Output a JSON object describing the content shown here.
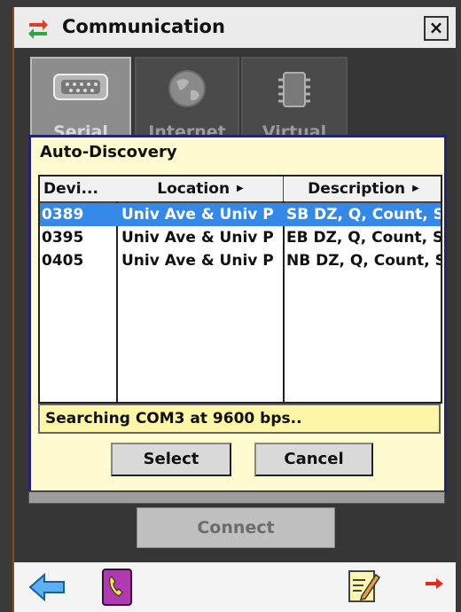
{
  "window": {
    "title": "Communication",
    "close_label": "×"
  },
  "tabs": [
    {
      "label": "Serial",
      "icon": "serial-port-icon"
    },
    {
      "label": "Internet",
      "icon": "globe-icon"
    },
    {
      "label": "Virtual",
      "icon": "chip-icon"
    }
  ],
  "dialog": {
    "title": "Auto-Discovery",
    "columns": [
      "Devi...",
      "Location",
      "Description"
    ],
    "rows": [
      {
        "device": "0389",
        "location": "Univ Ave & Univ P",
        "description": "SB DZ, Q, Count, S",
        "selected": true
      },
      {
        "device": "0395",
        "location": "Univ Ave & Univ P",
        "description": "EB DZ, Q, Count, S",
        "selected": false
      },
      {
        "device": "0405",
        "location": "Univ Ave & Univ P",
        "description": "NB DZ, Q, Count, S",
        "selected": false
      }
    ],
    "status": "Searching COM3 at 9600 bps..",
    "select_label": "Select",
    "cancel_label": "Cancel"
  },
  "connect_label": "Connect",
  "bottom_icons": [
    "back-arrow-icon",
    "phonebook-icon",
    "notepad-edit-icon",
    "red-arrow-icon"
  ],
  "colors": {
    "selection": "#3388e8",
    "dialog_bg": "#fffbd0",
    "status_bg": "#fdf6a6",
    "dialog_border": "#23237a"
  }
}
